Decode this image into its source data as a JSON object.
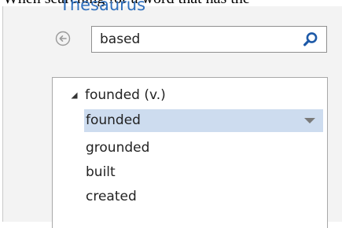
{
  "document": {
    "text": "When searching for a word that has the"
  },
  "pane": {
    "heading": "Thesaurus"
  },
  "search": {
    "value": "based",
    "back_icon": "back-arrow-circle-icon",
    "search_icon": "magnifier-icon"
  },
  "results": {
    "group": {
      "label": "founded (v.)",
      "expanded": true
    },
    "items": [
      {
        "label": "founded",
        "selected": true
      },
      {
        "label": "grounded"
      },
      {
        "label": "built"
      },
      {
        "label": "created"
      }
    ]
  },
  "colors": {
    "pane_background": "#f3f3f3",
    "selection": "#cddcef",
    "search_icon": "#1e5aa8",
    "heading": "#2f6fbd"
  }
}
